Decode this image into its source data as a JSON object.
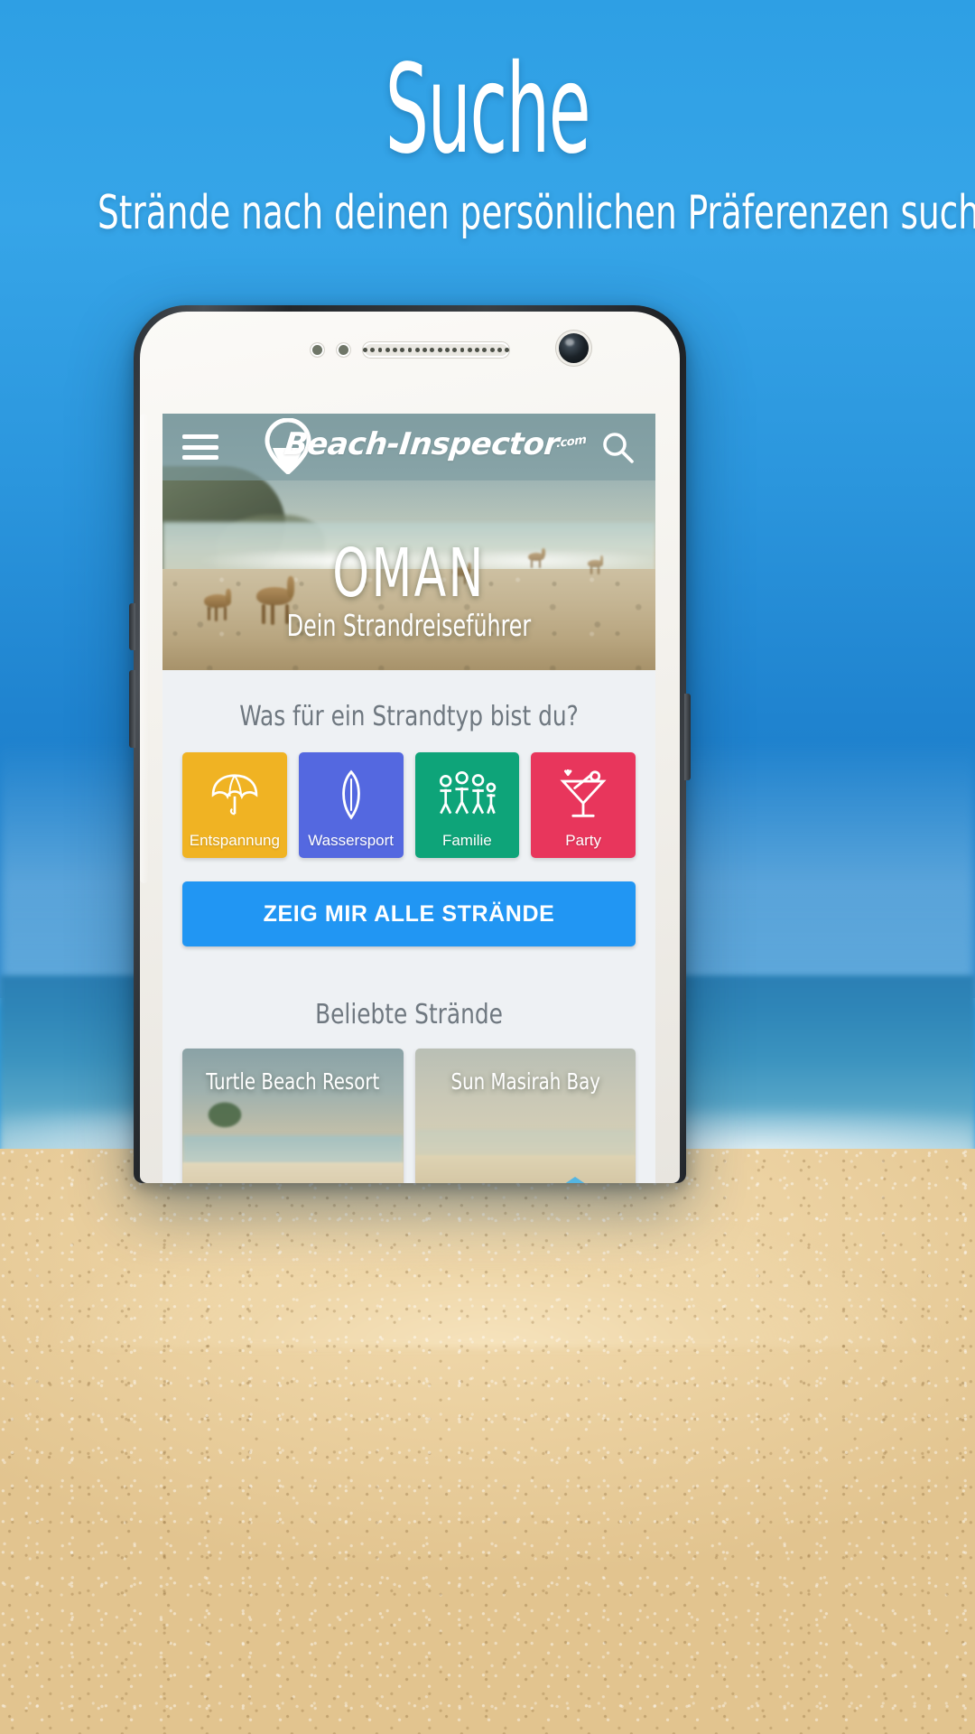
{
  "page": {
    "headline": "Suche",
    "subheadline": "Strände nach deinen persönlichen Präferenzen suchen"
  },
  "app": {
    "topbar": {
      "menu_icon": "hamburger-menu-icon",
      "logo_text": "Beach-Inspector",
      "logo_tld": ".com",
      "logo_pin_icon": "map-pin-icon",
      "search_icon": "search-icon"
    },
    "hero": {
      "title": "OMAN",
      "subtitle": "Dein Strandreiseführer"
    },
    "question": "Was für ein Strandtyp bist du?",
    "tiles": [
      {
        "label": "Entspannung",
        "icon": "beach-umbrella-icon",
        "color": "#f0b323"
      },
      {
        "label": "Wassersport",
        "icon": "surfboard-icon",
        "color": "#5468e0"
      },
      {
        "label": "Familie",
        "icon": "family-icon",
        "color": "#0ea479"
      },
      {
        "label": "Party",
        "icon": "cocktail-glass-icon",
        "color": "#e8365c"
      }
    ],
    "cta": {
      "label": "ZEIG MIR ALLE STRÄNDE",
      "color": "#2196f3"
    },
    "popular_section": {
      "title": "Beliebte Strände"
    },
    "beach_cards": [
      {
        "title": "Turtle Beach Resort",
        "badges": [
          "#f0b323",
          "#0ea479",
          "#5468e0"
        ]
      },
      {
        "title": "Sun Masirah Bay",
        "badges": []
      }
    ]
  }
}
